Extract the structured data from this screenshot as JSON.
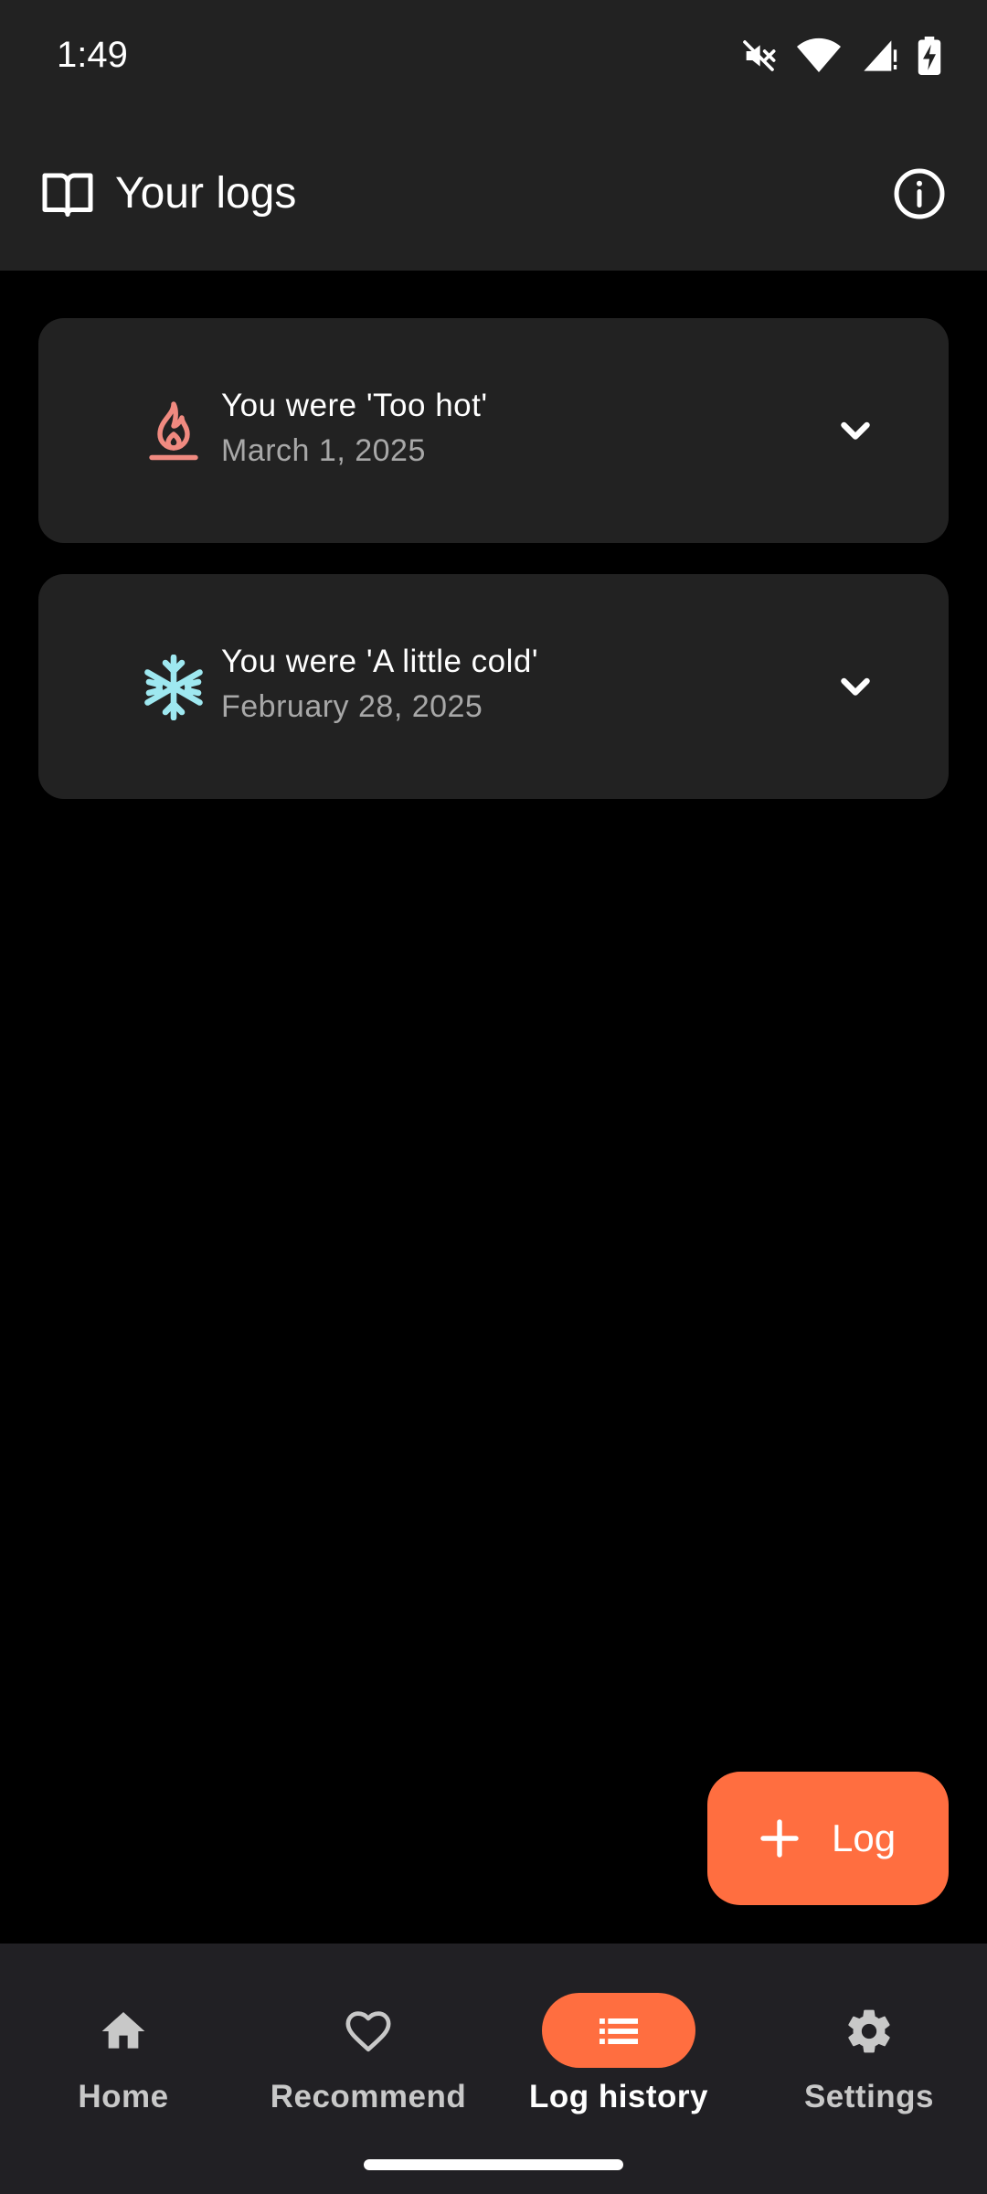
{
  "status_bar": {
    "time": "1:49",
    "icons": [
      "mute-icon",
      "wifi-icon",
      "signal-icon",
      "battery-charging-icon"
    ]
  },
  "app_bar": {
    "icon": "book-open-icon",
    "title": "Your logs",
    "action_icon": "info-icon"
  },
  "logs": [
    {
      "icon": "flame-icon",
      "icon_color": "#f08a80",
      "title": "You were 'Too hot'",
      "date": "March 1, 2025"
    },
    {
      "icon": "snowflake-icon",
      "icon_color": "#9ee8f0",
      "title": "You were 'A little cold'",
      "date": "February 28, 2025"
    }
  ],
  "fab": {
    "icon": "plus-icon",
    "label": "Log",
    "color": "#ff6e40"
  },
  "bottom_nav": {
    "items": [
      {
        "label": "Home",
        "icon": "home-icon",
        "active": false
      },
      {
        "label": "Recommend",
        "icon": "heart-icon",
        "active": false
      },
      {
        "label": "Log history",
        "icon": "list-icon",
        "active": true
      },
      {
        "label": "Settings",
        "icon": "gear-icon",
        "active": false
      }
    ],
    "accent": "#ff6e40"
  }
}
